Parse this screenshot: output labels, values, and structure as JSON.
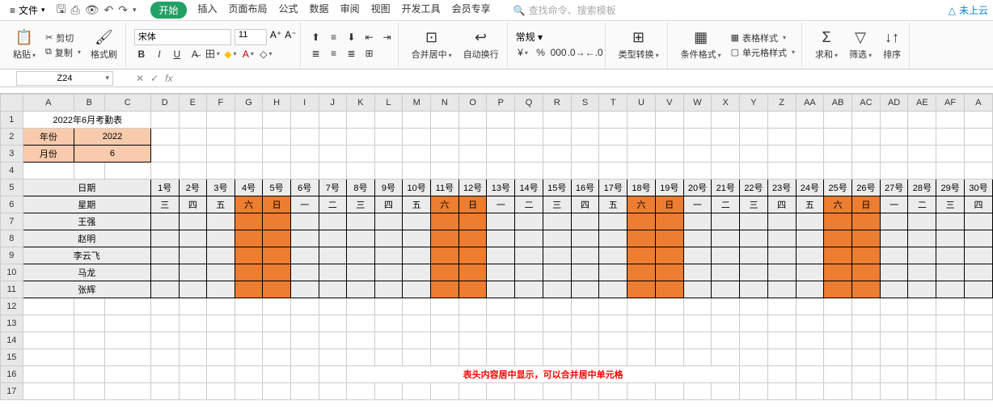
{
  "menubar": {
    "file": "文件",
    "tabs": [
      "开始",
      "插入",
      "页面布局",
      "公式",
      "数据",
      "审阅",
      "视图",
      "开发工具",
      "会员专享"
    ],
    "active_tab": 0,
    "search_placeholder": "查找命令、搜索模板",
    "cloud": "未上云"
  },
  "ribbon": {
    "paste": "粘贴",
    "cut": "剪切",
    "copy": "复制",
    "format_painter": "格式刷",
    "font_name": "宋体",
    "font_size": "11",
    "merge": "合并居中",
    "wrap": "自动换行",
    "number_format": "常规",
    "type_convert": "类型转换",
    "cond_format": "条件格式",
    "table_style": "表格样式",
    "cell_style": "单元格样式",
    "sum": "求和",
    "filter": "筛选",
    "sort": "排序"
  },
  "namebox": "Z24",
  "fx_label": "fx",
  "columns": [
    "A",
    "B",
    "C",
    "D",
    "E",
    "F",
    "G",
    "H",
    "I",
    "J",
    "K",
    "L",
    "M",
    "N",
    "O",
    "P",
    "Q",
    "R",
    "S",
    "T",
    "U",
    "V",
    "W",
    "X",
    "Y",
    "Z",
    "AA",
    "AB",
    "AC",
    "AD",
    "AE",
    "AF",
    "A"
  ],
  "selected_col": "Z",
  "rows": [
    "1",
    "2",
    "3",
    "4",
    "5",
    "6",
    "7",
    "8",
    "9",
    "10",
    "11",
    "12",
    "13",
    "14",
    "15",
    "16",
    "17"
  ],
  "sheet": {
    "title": "2022年6月考勤表",
    "year_label": "年份",
    "year_value": "2022",
    "month_label": "月份",
    "month_value": "6",
    "date_label": "日期",
    "week_label": "星期",
    "dates": [
      "1号",
      "2号",
      "3号",
      "4号",
      "5号",
      "6号",
      "7号",
      "8号",
      "9号",
      "10号",
      "11号",
      "12号",
      "13号",
      "14号",
      "15号",
      "16号",
      "17号",
      "18号",
      "19号",
      "20号",
      "21号",
      "22号",
      "23号",
      "24号",
      "25号",
      "26号",
      "27号",
      "28号",
      "29号",
      "30号"
    ],
    "weekdays": [
      "三",
      "四",
      "五",
      "六",
      "日",
      "一",
      "二",
      "三",
      "四",
      "五",
      "六",
      "日",
      "一",
      "二",
      "三",
      "四",
      "五",
      "六",
      "日",
      "一",
      "二",
      "三",
      "四",
      "五",
      "六",
      "日",
      "一",
      "二",
      "三",
      "四"
    ],
    "weekend_cols": [
      3,
      4,
      10,
      11,
      17,
      18,
      24,
      25
    ],
    "names": [
      "王强",
      "赵明",
      "李云飞",
      "马龙",
      "张辉"
    ],
    "footer_note": "表头内容居中显示，可以合并居中单元格"
  }
}
